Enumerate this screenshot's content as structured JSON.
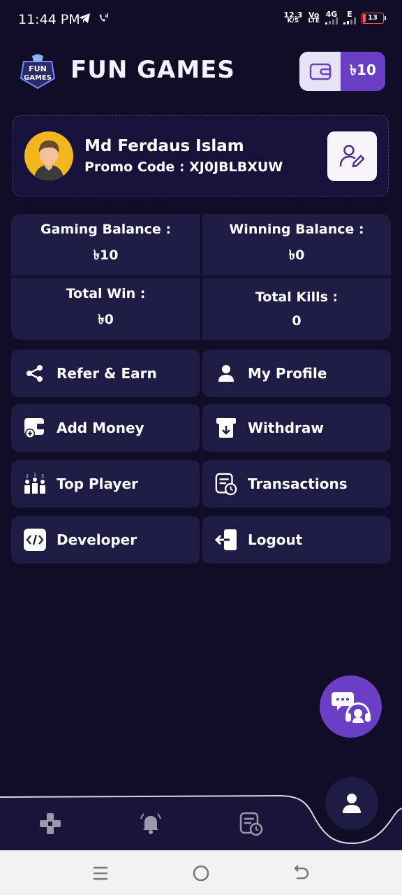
{
  "status_bar": {
    "time": "11:44 PM",
    "net_speed_value": "12.3",
    "net_speed_unit": "K/S",
    "volte_label_top": "Vo",
    "volte_label_bottom": "LTE",
    "network_4g": "4G",
    "network_e": "E",
    "battery": "13"
  },
  "header": {
    "logo_line1": "FUN",
    "logo_line2": "GAMES",
    "title": "FUN GAMES",
    "wallet_balance": "৳10"
  },
  "profile": {
    "name": "Md Ferdaus Islam",
    "promo_code": "Promo Code : XJ0JBLBXUW"
  },
  "stats": [
    {
      "label": "Gaming Balance :",
      "value": "৳10"
    },
    {
      "label": "Winning Balance :",
      "value": "৳0"
    },
    {
      "label": "Total Win :",
      "value": "৳0"
    },
    {
      "label": "Total Kills :",
      "value": "0"
    }
  ],
  "menu": [
    {
      "label": "Refer & Earn",
      "icon": "share-icon"
    },
    {
      "label": "My Profile",
      "icon": "user-icon"
    },
    {
      "label": "Add Money",
      "icon": "add-money-icon"
    },
    {
      "label": "Withdraw",
      "icon": "withdraw-icon"
    },
    {
      "label": "Top Player",
      "icon": "leaderboard-icon"
    },
    {
      "label": "Transactions",
      "icon": "transactions-icon"
    },
    {
      "label": "Developer",
      "icon": "code-icon"
    },
    {
      "label": "Logout",
      "icon": "logout-icon"
    }
  ],
  "colors": {
    "background": "#110d27",
    "card": "#1e1b44",
    "accent": "#6a3fc6",
    "wallet_light": "#e7e3f5"
  }
}
